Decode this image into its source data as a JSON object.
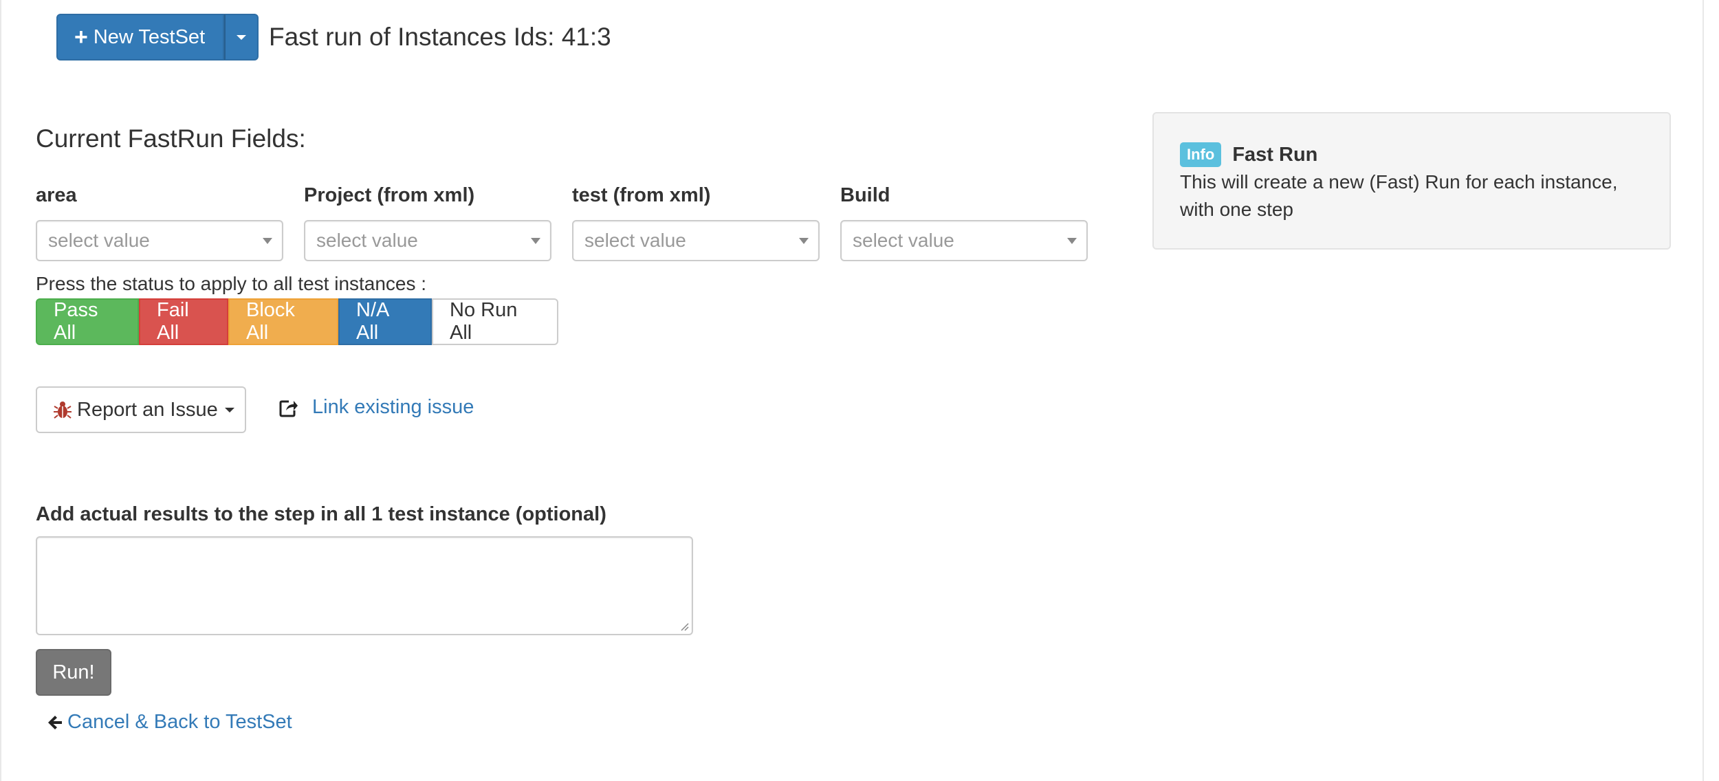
{
  "header": {
    "new_testset_label": "New TestSet",
    "title": "Fast run of Instances Ids: 41:3"
  },
  "fields_section": {
    "title": "Current FastRun Fields:",
    "fields": [
      {
        "label": "area",
        "placeholder": "select value"
      },
      {
        "label": "Project (from xml)",
        "placeholder": "select value"
      },
      {
        "label": "test (from xml)",
        "placeholder": "select value"
      },
      {
        "label": "Build",
        "placeholder": "select value"
      }
    ]
  },
  "info_box": {
    "badge": "Info",
    "title": "Fast Run",
    "text_line1": "This will create a new (Fast) Run for each instance,",
    "text_line2": "with one step"
  },
  "status": {
    "prompt": "Press the status to apply to all test instances :",
    "buttons": {
      "pass": "Pass All",
      "fail": "Fail All",
      "block": "Block All",
      "na": "N/A All",
      "norun": "No Run All"
    }
  },
  "issues": {
    "report_label": "Report an Issue",
    "link_label": "Link existing issue"
  },
  "results": {
    "label": "Add actual results to the step in all 1 test instance (optional)",
    "value": ""
  },
  "actions": {
    "run_label": "Run!",
    "cancel_label": "Cancel & Back to TestSet"
  },
  "colors": {
    "primary": "#337ab7",
    "success": "#5cb85c",
    "danger": "#d9534f",
    "warning": "#f0ad4e",
    "info": "#5bc0de",
    "run": "#777777"
  }
}
